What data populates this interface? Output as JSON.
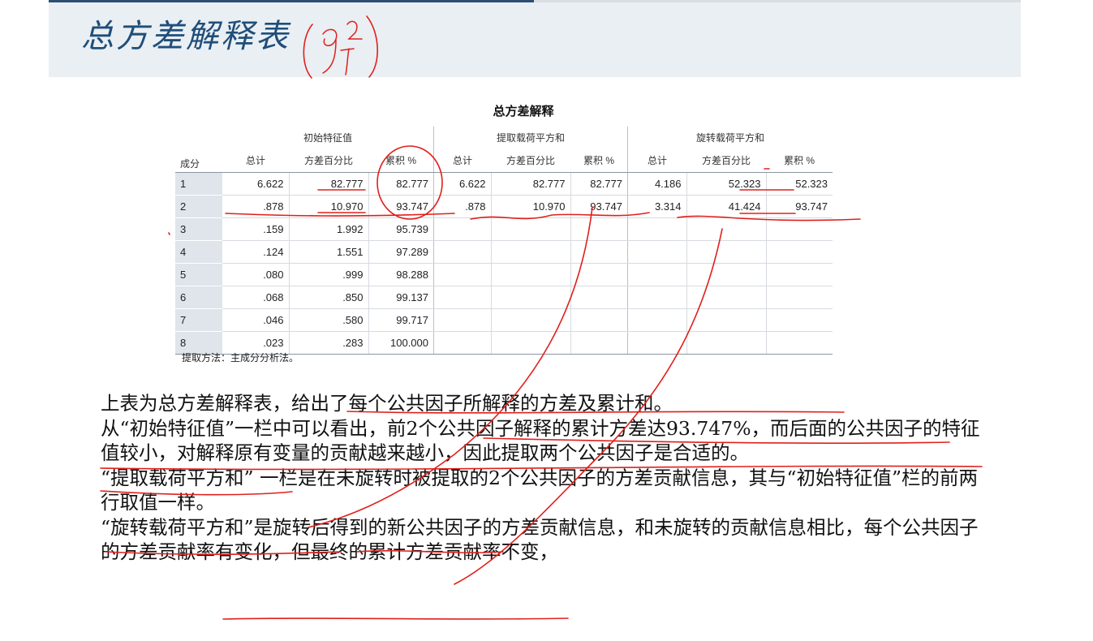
{
  "slide": {
    "title": "总方差解释表"
  },
  "annotations": {
    "handwritten_note": "9²₁"
  },
  "table": {
    "title": "总方差解释",
    "row_header": "成分",
    "groups": [
      "初始特征值",
      "提取载荷平方和",
      "旋转载荷平方和"
    ],
    "columns": [
      "总计",
      "方差百分比",
      "累积 %",
      "总计",
      "方差百分比",
      "累积 %",
      "总计",
      "方差百分比",
      "累积 %"
    ],
    "rows": [
      {
        "component": "1",
        "values": [
          "6.622",
          "82.777",
          "82.777",
          "6.622",
          "82.777",
          "82.777",
          "4.186",
          "52.323",
          "52.323"
        ]
      },
      {
        "component": "2",
        "values": [
          ".878",
          "10.970",
          "93.747",
          ".878",
          "10.970",
          "93.747",
          "3.314",
          "41.424",
          "93.747"
        ]
      },
      {
        "component": "3",
        "values": [
          ".159",
          "1.992",
          "95.739",
          "",
          "",
          "",
          "",
          "",
          ""
        ]
      },
      {
        "component": "4",
        "values": [
          ".124",
          "1.551",
          "97.289",
          "",
          "",
          "",
          "",
          "",
          ""
        ]
      },
      {
        "component": "5",
        "values": [
          ".080",
          ".999",
          "98.288",
          "",
          "",
          "",
          "",
          "",
          ""
        ]
      },
      {
        "component": "6",
        "values": [
          ".068",
          ".850",
          "99.137",
          "",
          "",
          "",
          "",
          "",
          ""
        ]
      },
      {
        "component": "7",
        "values": [
          ".046",
          ".580",
          "99.717",
          "",
          "",
          "",
          "",
          "",
          ""
        ]
      },
      {
        "component": "8",
        "values": [
          ".023",
          ".283",
          "100.000",
          "",
          "",
          "",
          "",
          "",
          ""
        ]
      }
    ],
    "footnote": "提取方法：主成分分析法。"
  },
  "paragraphs": [
    "上表为总方差解释表，给出了每个公共因子所解释的方差及累计和。",
    "从“初始特征值”一栏中可以看出，前2个公共因子解释的累计方差达93.747%，而后面的公共因子的特征值较小，对解释原有变量的贡献越来越小，因此提取两个公共因子是合适的。",
    "“提取载荷平方和” 一栏是在未旋转时被提取的2个公共因子的方差贡献信息，其与“初始特征值”栏的前两行取值一样。",
    "“旋转载荷平方和”是旋转后得到的新公共因子的方差贡献信息，和未旋转的贡献信息相比，每个公共因子的方差贡献率有变化，但最终的累计方差贡献率不变，"
  ],
  "colors": {
    "title": "#1f4e79",
    "ink": "#e0201c",
    "band": "#e9eff3"
  }
}
